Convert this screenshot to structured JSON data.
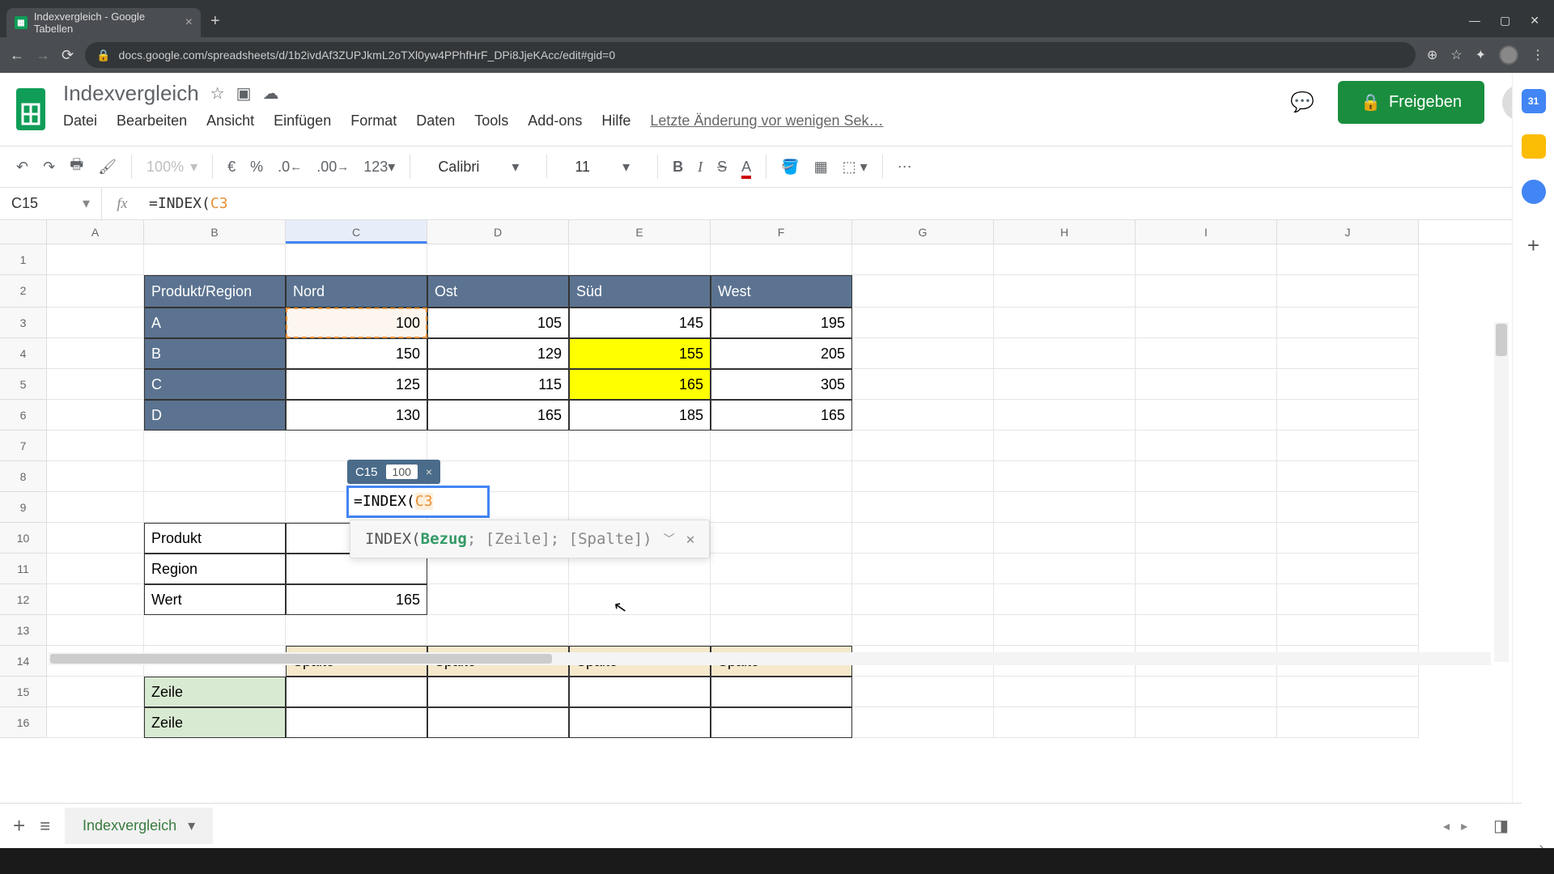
{
  "browser": {
    "tab_title": "Indexvergleich - Google Tabellen",
    "url": "docs.google.com/spreadsheets/d/1b2ivdAf3ZUPJkmL2oTXl0yw4PPhfHrF_DPi8JjeKAcc/edit#gid=0"
  },
  "doc": {
    "title": "Indexvergleich",
    "menus": [
      "Datei",
      "Bearbeiten",
      "Ansicht",
      "Einfügen",
      "Format",
      "Daten",
      "Tools",
      "Add-ons",
      "Hilfe"
    ],
    "last_edit": "Letzte Änderung vor wenigen Sek…",
    "share_label": "Freigeben"
  },
  "toolbar": {
    "zoom": "100%",
    "currency": "€",
    "percent": "%",
    "dec_dec": ".0",
    "dec_inc": ".00",
    "numfmt": "123",
    "font": "Calibri",
    "font_size": "11"
  },
  "fx": {
    "name_box": "C15",
    "formula_prefix": "=INDEX(",
    "formula_ref": "C3"
  },
  "columns": [
    "A",
    "B",
    "C",
    "D",
    "E",
    "F",
    "G",
    "H",
    "I",
    "J"
  ],
  "rows": [
    "1",
    "2",
    "3",
    "4",
    "5",
    "6",
    "7",
    "8",
    "9",
    "10",
    "11",
    "12",
    "13",
    "14",
    "15",
    "16"
  ],
  "table": {
    "corner": "Produkt/Region",
    "col_headers": [
      "Nord",
      "Ost",
      "Süd",
      "West"
    ],
    "row_headers": [
      "A",
      "B",
      "C",
      "D"
    ],
    "data": [
      [
        100,
        105,
        145,
        195
      ],
      [
        150,
        129,
        155,
        205
      ],
      [
        125,
        115,
        165,
        305
      ],
      [
        130,
        165,
        185,
        165
      ]
    ]
  },
  "lookup": {
    "labels": [
      "Produkt",
      "Region",
      "Wert"
    ],
    "wert_value": "165"
  },
  "edit": {
    "chip_cell": "C15",
    "chip_value": "100",
    "cell_text_prefix": "=INDEX(",
    "cell_text_ref": "C3",
    "hint_fn": "INDEX(",
    "hint_active": "Bezug",
    "hint_rest": "; [Zeile]; [Spalte])"
  },
  "matrix": {
    "spalte": "Spalte",
    "zeile": "Zeile"
  },
  "sheet_tab": "Indexvergleich",
  "side_cal": "31"
}
